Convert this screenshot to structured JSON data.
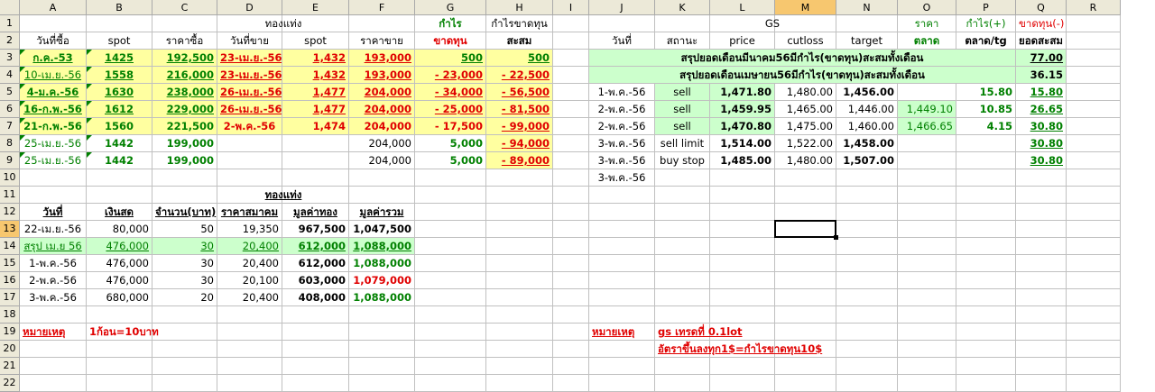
{
  "sheet": {
    "columns": [
      "A",
      "B",
      "C",
      "D",
      "E",
      "F",
      "G",
      "H",
      "I",
      "J",
      "K",
      "L",
      "M",
      "N",
      "O",
      "P",
      "Q",
      "R"
    ],
    "selected_column": "M",
    "selected_row": "13",
    "rows": [
      "1",
      "2",
      "3",
      "4",
      "5",
      "6",
      "7",
      "8",
      "9",
      "10",
      "11",
      "12",
      "13",
      "14",
      "15",
      "16",
      "17",
      "18",
      "19",
      "20",
      "21",
      "22"
    ]
  },
  "colors": {
    "yellow": "#ffffa0",
    "green_fill": "#ccffcc",
    "red": "#e00000",
    "green_text": "#008000"
  },
  "cells": [
    {
      "r": 1,
      "c": "C",
      "span": 4,
      "t": "ทองแท่ง",
      "a": "c"
    },
    {
      "r": 1,
      "c": "G",
      "t": "กำไร",
      "a": "c",
      "s": "g b"
    },
    {
      "r": 1,
      "c": "H",
      "t": "กำไรขาดทุน",
      "a": "c"
    },
    {
      "r": 1,
      "c": "J",
      "span": 6,
      "t": "GS",
      "a": "c"
    },
    {
      "r": 1,
      "c": "O",
      "t": "ราคา",
      "a": "c",
      "s": "g"
    },
    {
      "r": 1,
      "c": "P",
      "t": "กำไร(+)",
      "a": "c",
      "s": "g"
    },
    {
      "r": 1,
      "c": "Q",
      "t": "ขาดทุน(-)",
      "a": "c",
      "s": "red"
    },
    {
      "r": 2,
      "c": "A",
      "t": "วันที่ซื้อ",
      "a": "c"
    },
    {
      "r": 2,
      "c": "B",
      "t": "spot",
      "a": "c"
    },
    {
      "r": 2,
      "c": "C",
      "t": "ราคาซื้อ",
      "a": "c"
    },
    {
      "r": 2,
      "c": "D",
      "t": "วันที่ขาย",
      "a": "c"
    },
    {
      "r": 2,
      "c": "E",
      "t": "spot",
      "a": "c"
    },
    {
      "r": 2,
      "c": "F",
      "t": "ราคาขาย",
      "a": "c"
    },
    {
      "r": 2,
      "c": "G",
      "t": "ขาดทุน",
      "a": "c",
      "s": "red b"
    },
    {
      "r": 2,
      "c": "H",
      "t": "สะสม",
      "a": "c",
      "s": "b"
    },
    {
      "r": 2,
      "c": "J",
      "t": "วันที่",
      "a": "c"
    },
    {
      "r": 2,
      "c": "K",
      "t": "สถานะ",
      "a": "c"
    },
    {
      "r": 2,
      "c": "L",
      "t": "price",
      "a": "c"
    },
    {
      "r": 2,
      "c": "M",
      "t": "cutloss",
      "a": "c"
    },
    {
      "r": 2,
      "c": "N",
      "t": "target",
      "a": "c"
    },
    {
      "r": 2,
      "c": "O",
      "t": "ตลาด",
      "a": "c",
      "s": "g b"
    },
    {
      "r": 2,
      "c": "P",
      "t": "ตลาด/tg",
      "a": "c",
      "s": "b"
    },
    {
      "r": 2,
      "c": "Q",
      "t": "ยอดสะสม",
      "a": "c",
      "s": "b"
    },
    {
      "r": 3,
      "c": "A",
      "t": "ก.ค.-53",
      "a": "c",
      "s": "g b u",
      "bg": "yel",
      "tri": true
    },
    {
      "r": 3,
      "c": "B",
      "t": "1425",
      "a": "c",
      "s": "g b u",
      "bg": "yel",
      "tri": true
    },
    {
      "r": 3,
      "c": "C",
      "t": "192,500",
      "a": "r",
      "s": "g b u",
      "bg": "yel"
    },
    {
      "r": 3,
      "c": "D",
      "t": "23-เม.ย.-56",
      "a": "c",
      "s": "red b u",
      "bg": "yel"
    },
    {
      "r": 3,
      "c": "E",
      "t": "1,432",
      "a": "r",
      "s": "red b u",
      "bg": "yel"
    },
    {
      "r": 3,
      "c": "F",
      "t": "193,000",
      "a": "r",
      "s": "red b u",
      "bg": "yel"
    },
    {
      "r": 3,
      "c": "G",
      "t": "500",
      "a": "r",
      "s": "g b u",
      "bg": "yel"
    },
    {
      "r": 3,
      "c": "H",
      "t": "500",
      "a": "r",
      "s": "g b u",
      "bg": "yel"
    },
    {
      "r": 3,
      "c": "J",
      "span": 7,
      "t": "สรุปยอดเดือนมีนาคม56มีกำไร(ขาดทุน)สะสมทั้งเดือน",
      "a": "c",
      "s": "b",
      "bg": "grn"
    },
    {
      "r": 3,
      "c": "Q",
      "t": "77.00",
      "a": "r",
      "s": "b u",
      "bg": "grn"
    },
    {
      "r": 4,
      "c": "A",
      "t": "10-เม.ย.-56",
      "a": "c",
      "s": "g u",
      "bg": "yel",
      "tri": true
    },
    {
      "r": 4,
      "c": "B",
      "t": "1558",
      "a": "c",
      "s": "g b u",
      "bg": "yel",
      "tri": true
    },
    {
      "r": 4,
      "c": "C",
      "t": "216,000",
      "a": "r",
      "s": "g b u",
      "bg": "yel"
    },
    {
      "r": 4,
      "c": "D",
      "t": "23-เม.ย.-56",
      "a": "c",
      "s": "red b u",
      "bg": "yel"
    },
    {
      "r": 4,
      "c": "E",
      "t": "1,432",
      "a": "r",
      "s": "red b u",
      "bg": "yel"
    },
    {
      "r": 4,
      "c": "F",
      "t": "193,000",
      "a": "r",
      "s": "red b u",
      "bg": "yel"
    },
    {
      "r": 4,
      "c": "G",
      "t": "-     23,000",
      "a": "r",
      "s": "red b u",
      "bg": "yel"
    },
    {
      "r": 4,
      "c": "H",
      "t": "-     22,500",
      "a": "r",
      "s": "red b u",
      "bg": "yel"
    },
    {
      "r": 4,
      "c": "J",
      "span": 7,
      "t": "สรุปยอดเดือนเมษายน56มีกำไร(ขาดทุน)สะสมทั้งเดือน",
      "a": "c",
      "s": "b",
      "bg": "grn"
    },
    {
      "r": 4,
      "c": "Q",
      "t": "36.15",
      "a": "r",
      "s": "b",
      "bg": "grn"
    },
    {
      "r": 5,
      "c": "A",
      "t": "4-ม.ค.-56",
      "a": "c",
      "s": "g b u",
      "bg": "yel",
      "tri": true
    },
    {
      "r": 5,
      "c": "B",
      "t": "1630",
      "a": "c",
      "s": "g b u",
      "bg": "yel",
      "tri": true
    },
    {
      "r": 5,
      "c": "C",
      "t": "238,000",
      "a": "r",
      "s": "g b u",
      "bg": "yel"
    },
    {
      "r": 5,
      "c": "D",
      "t": "26-เม.ย.-56",
      "a": "c",
      "s": "red b u",
      "bg": "yel"
    },
    {
      "r": 5,
      "c": "E",
      "t": "1,477",
      "a": "r",
      "s": "red b u",
      "bg": "yel"
    },
    {
      "r": 5,
      "c": "F",
      "t": "204,000",
      "a": "r",
      "s": "red b u",
      "bg": "yel"
    },
    {
      "r": 5,
      "c": "G",
      "t": "-     34,000",
      "a": "r",
      "s": "red b u",
      "bg": "yel"
    },
    {
      "r": 5,
      "c": "H",
      "t": "-     56,500",
      "a": "r",
      "s": "red b u",
      "bg": "yel"
    },
    {
      "r": 5,
      "c": "J",
      "t": "1-พ.ค.-56",
      "a": "c"
    },
    {
      "r": 5,
      "c": "K",
      "t": "sell",
      "a": "c",
      "bg": "grn"
    },
    {
      "r": 5,
      "c": "L",
      "t": "1,471.80",
      "a": "r",
      "s": "b",
      "bg": "grn"
    },
    {
      "r": 5,
      "c": "M",
      "t": "1,480.00",
      "a": "r"
    },
    {
      "r": 5,
      "c": "N",
      "t": "1,456.00",
      "a": "r",
      "s": "b"
    },
    {
      "r": 5,
      "c": "P",
      "t": "15.80",
      "a": "r",
      "s": "g b"
    },
    {
      "r": 5,
      "c": "Q",
      "t": "15.80",
      "a": "r",
      "s": "g b u"
    },
    {
      "r": 6,
      "c": "A",
      "t": "16-ก.พ.-56",
      "a": "c",
      "s": "g b u",
      "bg": "yel",
      "tri": true
    },
    {
      "r": 6,
      "c": "B",
      "t": "1612",
      "a": "c",
      "s": "g b u",
      "bg": "yel",
      "tri": true
    },
    {
      "r": 6,
      "c": "C",
      "t": "229,000",
      "a": "r",
      "s": "g b u",
      "bg": "yel"
    },
    {
      "r": 6,
      "c": "D",
      "t": "26-เม.ย.-56",
      "a": "c",
      "s": "red b u",
      "bg": "yel"
    },
    {
      "r": 6,
      "c": "E",
      "t": "1,477",
      "a": "r",
      "s": "red b u",
      "bg": "yel"
    },
    {
      "r": 6,
      "c": "F",
      "t": "204,000",
      "a": "r",
      "s": "red b u",
      "bg": "yel"
    },
    {
      "r": 6,
      "c": "G",
      "t": "-     25,000",
      "a": "r",
      "s": "red b u",
      "bg": "yel"
    },
    {
      "r": 6,
      "c": "H",
      "t": "-     81,500",
      "a": "r",
      "s": "red b u",
      "bg": "yel"
    },
    {
      "r": 6,
      "c": "J",
      "t": "2-พ.ค.-56",
      "a": "c"
    },
    {
      "r": 6,
      "c": "K",
      "t": "sell",
      "a": "c",
      "bg": "grn"
    },
    {
      "r": 6,
      "c": "L",
      "t": "1,459.95",
      "a": "r",
      "s": "b",
      "bg": "grn"
    },
    {
      "r": 6,
      "c": "M",
      "t": "1,465.00",
      "a": "r"
    },
    {
      "r": 6,
      "c": "N",
      "t": "1,446.00",
      "a": "r"
    },
    {
      "r": 6,
      "c": "O",
      "t": "1,449.10",
      "a": "r",
      "s": "g",
      "bg": "grn"
    },
    {
      "r": 6,
      "c": "P",
      "t": "10.85",
      "a": "r",
      "s": "g b"
    },
    {
      "r": 6,
      "c": "Q",
      "t": "26.65",
      "a": "r",
      "s": "g b u"
    },
    {
      "r": 7,
      "c": "A",
      "t": "21-ก.พ.-56",
      "a": "c",
      "s": "g b",
      "bg": "yel",
      "tri": true
    },
    {
      "r": 7,
      "c": "B",
      "t": "1560",
      "a": "c",
      "s": "g b",
      "bg": "yel",
      "tri": true
    },
    {
      "r": 7,
      "c": "C",
      "t": "221,500",
      "a": "r",
      "s": "g b",
      "bg": "yel"
    },
    {
      "r": 7,
      "c": "D",
      "t": "2-พ.ค.-56",
      "a": "c",
      "s": "red b",
      "bg": "yel"
    },
    {
      "r": 7,
      "c": "E",
      "t": "1,474",
      "a": "r",
      "s": "red b",
      "bg": "yel"
    },
    {
      "r": 7,
      "c": "F",
      "t": "204,000",
      "a": "r",
      "s": "red b",
      "bg": "yel"
    },
    {
      "r": 7,
      "c": "G",
      "t": "-     17,500",
      "a": "r",
      "s": "red b",
      "bg": "yel"
    },
    {
      "r": 7,
      "c": "H",
      "t": "-     99,000",
      "a": "r",
      "s": "red b u",
      "bg": "yel"
    },
    {
      "r": 7,
      "c": "J",
      "t": "2-พ.ค.-56",
      "a": "c"
    },
    {
      "r": 7,
      "c": "K",
      "t": "sell",
      "a": "c",
      "bg": "grn"
    },
    {
      "r": 7,
      "c": "L",
      "t": "1,470.80",
      "a": "r",
      "s": "b",
      "bg": "grn"
    },
    {
      "r": 7,
      "c": "M",
      "t": "1,475.00",
      "a": "r"
    },
    {
      "r": 7,
      "c": "N",
      "t": "1,460.00",
      "a": "r"
    },
    {
      "r": 7,
      "c": "O",
      "t": "1,466.65",
      "a": "r",
      "s": "g",
      "bg": "grn"
    },
    {
      "r": 7,
      "c": "P",
      "t": "4.15",
      "a": "r",
      "s": "g b"
    },
    {
      "r": 7,
      "c": "Q",
      "t": "30.80",
      "a": "r",
      "s": "g b u"
    },
    {
      "r": 8,
      "c": "A",
      "t": "25-เม.ย.-56",
      "a": "c",
      "s": "g",
      "tri": true
    },
    {
      "r": 8,
      "c": "B",
      "t": "1442",
      "a": "c",
      "s": "g b",
      "tri": true
    },
    {
      "r": 8,
      "c": "C",
      "t": "199,000",
      "a": "r",
      "s": "g b"
    },
    {
      "r": 8,
      "c": "F",
      "t": "204,000",
      "a": "r"
    },
    {
      "r": 8,
      "c": "G",
      "t": "5,000",
      "a": "r",
      "s": "g b"
    },
    {
      "r": 8,
      "c": "H",
      "t": "-     94,000",
      "a": "r",
      "s": "red b u",
      "bg": "yel"
    },
    {
      "r": 8,
      "c": "J",
      "t": "3-พ.ค.-56",
      "a": "c"
    },
    {
      "r": 8,
      "c": "K",
      "t": "sell limit",
      "a": "c"
    },
    {
      "r": 8,
      "c": "L",
      "t": "1,514.00",
      "a": "r",
      "s": "b"
    },
    {
      "r": 8,
      "c": "M",
      "t": "1,522.00",
      "a": "r"
    },
    {
      "r": 8,
      "c": "N",
      "t": "1,458.00",
      "a": "r",
      "s": "b"
    },
    {
      "r": 8,
      "c": "Q",
      "t": "30.80",
      "a": "r",
      "s": "g b u"
    },
    {
      "r": 9,
      "c": "A",
      "t": "25-เม.ย.-56",
      "a": "c",
      "s": "g",
      "tri": true
    },
    {
      "r": 9,
      "c": "B",
      "t": "1442",
      "a": "c",
      "s": "g b",
      "tri": true
    },
    {
      "r": 9,
      "c": "C",
      "t": "199,000",
      "a": "r",
      "s": "g b"
    },
    {
      "r": 9,
      "c": "F",
      "t": "204,000",
      "a": "r"
    },
    {
      "r": 9,
      "c": "G",
      "t": "5,000",
      "a": "r",
      "s": "g b"
    },
    {
      "r": 9,
      "c": "H",
      "t": "-     89,000",
      "a": "r",
      "s": "red b u",
      "bg": "yel"
    },
    {
      "r": 9,
      "c": "J",
      "t": "3-พ.ค.-56",
      "a": "c"
    },
    {
      "r": 9,
      "c": "K",
      "t": "buy stop",
      "a": "c"
    },
    {
      "r": 9,
      "c": "L",
      "t": "1,485.00",
      "a": "r",
      "s": "b"
    },
    {
      "r": 9,
      "c": "M",
      "t": "1,480.00",
      "a": "r"
    },
    {
      "r": 9,
      "c": "N",
      "t": "1,507.00",
      "a": "r",
      "s": "b"
    },
    {
      "r": 9,
      "c": "Q",
      "t": "30.80",
      "a": "r",
      "s": "g b u"
    },
    {
      "r": 10,
      "c": "J",
      "t": "3-พ.ค.-56",
      "a": "c"
    },
    {
      "r": 11,
      "c": "C",
      "span": 4,
      "t": "ทองแท่ง",
      "a": "c",
      "s": "b u"
    },
    {
      "r": 12,
      "c": "A",
      "t": "วันที่",
      "a": "c",
      "s": "b u"
    },
    {
      "r": 12,
      "c": "B",
      "t": "เงินสด",
      "a": "c",
      "s": "b u"
    },
    {
      "r": 12,
      "c": "C",
      "t": "จำนวน(บาท)",
      "a": "c",
      "s": "b u"
    },
    {
      "r": 12,
      "c": "D",
      "t": "ราคาสมาคม",
      "a": "c",
      "s": "b u"
    },
    {
      "r": 12,
      "c": "E",
      "t": "มูลค่าทอง",
      "a": "c",
      "s": "b u"
    },
    {
      "r": 12,
      "c": "F",
      "t": "มูลค่ารวม",
      "a": "c",
      "s": "b u"
    },
    {
      "r": 13,
      "c": "A",
      "t": "22-เม.ย.-56",
      "a": "c"
    },
    {
      "r": 13,
      "c": "B",
      "t": "80,000",
      "a": "r"
    },
    {
      "r": 13,
      "c": "C",
      "t": "50",
      "a": "r"
    },
    {
      "r": 13,
      "c": "D",
      "t": "19,350",
      "a": "r"
    },
    {
      "r": 13,
      "c": "E",
      "t": "967,500",
      "a": "r",
      "s": "b"
    },
    {
      "r": 13,
      "c": "F",
      "t": "1,047,500",
      "a": "r",
      "s": "b"
    },
    {
      "r": 14,
      "c": "A",
      "t": "สรุป เม.ย 56",
      "a": "c",
      "s": "g u",
      "bg": "grn"
    },
    {
      "r": 14,
      "c": "B",
      "t": "476,000",
      "a": "r",
      "s": "g u",
      "bg": "grn"
    },
    {
      "r": 14,
      "c": "C",
      "t": "30",
      "a": "r",
      "s": "g u",
      "bg": "grn"
    },
    {
      "r": 14,
      "c": "D",
      "t": "20,400",
      "a": "r",
      "s": "g u",
      "bg": "grn"
    },
    {
      "r": 14,
      "c": "E",
      "t": "612,000",
      "a": "r",
      "s": "g b u",
      "bg": "grn"
    },
    {
      "r": 14,
      "c": "F",
      "t": "1,088,000",
      "a": "r",
      "s": "g b u",
      "bg": "grn"
    },
    {
      "r": 15,
      "c": "A",
      "t": "1-พ.ค.-56",
      "a": "c"
    },
    {
      "r": 15,
      "c": "B",
      "t": "476,000",
      "a": "r"
    },
    {
      "r": 15,
      "c": "C",
      "t": "30",
      "a": "r"
    },
    {
      "r": 15,
      "c": "D",
      "t": "20,400",
      "a": "r"
    },
    {
      "r": 15,
      "c": "E",
      "t": "612,000",
      "a": "r",
      "s": "b"
    },
    {
      "r": 15,
      "c": "F",
      "t": "1,088,000",
      "a": "r",
      "s": "g b"
    },
    {
      "r": 16,
      "c": "A",
      "t": "2-พ.ค.-56",
      "a": "c"
    },
    {
      "r": 16,
      "c": "B",
      "t": "476,000",
      "a": "r"
    },
    {
      "r": 16,
      "c": "C",
      "t": "30",
      "a": "r"
    },
    {
      "r": 16,
      "c": "D",
      "t": "20,100",
      "a": "r"
    },
    {
      "r": 16,
      "c": "E",
      "t": "603,000",
      "a": "r",
      "s": "b"
    },
    {
      "r": 16,
      "c": "F",
      "t": "1,079,000",
      "a": "r",
      "s": "red b"
    },
    {
      "r": 17,
      "c": "A",
      "t": "3-พ.ค.-56",
      "a": "c"
    },
    {
      "r": 17,
      "c": "B",
      "t": "680,000",
      "a": "r"
    },
    {
      "r": 17,
      "c": "C",
      "t": "20",
      "a": "r"
    },
    {
      "r": 17,
      "c": "D",
      "t": "20,400",
      "a": "r"
    },
    {
      "r": 17,
      "c": "E",
      "t": "408,000",
      "a": "r",
      "s": "b"
    },
    {
      "r": 17,
      "c": "F",
      "t": "1,088,000",
      "a": "r",
      "s": "g b"
    },
    {
      "r": 19,
      "c": "A",
      "t": "หมายเหตุ",
      "a": "l",
      "s": "red b u",
      "ov": true
    },
    {
      "r": 19,
      "c": "B",
      "t": "1ก้อน=10บาท",
      "a": "l",
      "s": "red b",
      "ov": true
    },
    {
      "r": 19,
      "c": "J",
      "t": "หมายเหตุ",
      "a": "l",
      "s": "red b u",
      "ov": true
    },
    {
      "r": 19,
      "c": "K",
      "t": "gs เทรดที่ 0.1lot",
      "a": "l",
      "s": "red b u",
      "ov": true
    },
    {
      "r": 20,
      "c": "K",
      "t": "อัตราขึ้นลงทุก1$=กำไรขาดทุน10$",
      "a": "l",
      "s": "red b u",
      "ov": true
    }
  ]
}
